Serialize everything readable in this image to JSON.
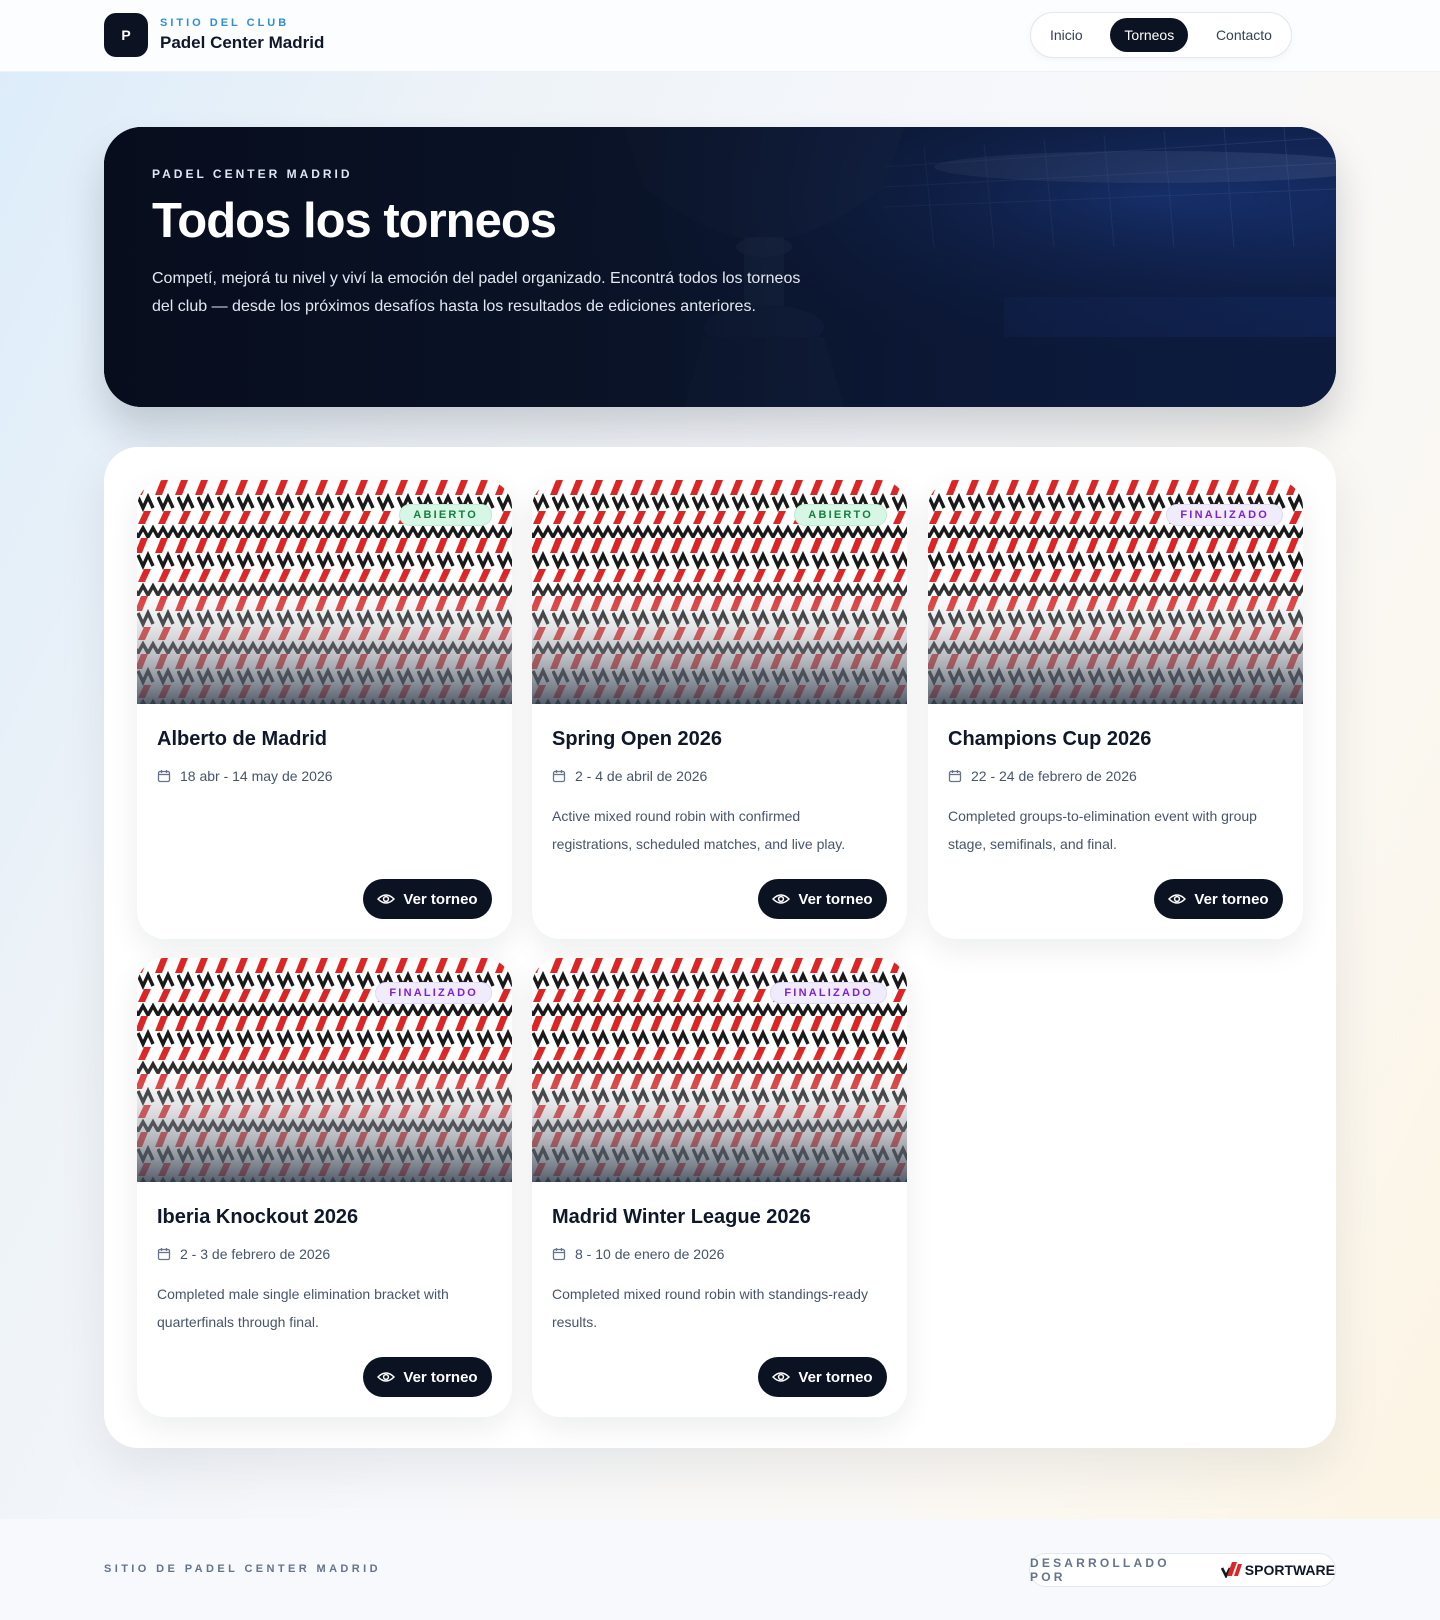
{
  "header": {
    "badge_letter": "P",
    "kicker": "SITIO DEL CLUB",
    "club_name": "Padel Center Madrid",
    "nav": [
      {
        "label": "Inicio",
        "active": false
      },
      {
        "label": "Torneos",
        "active": true
      },
      {
        "label": "Contacto",
        "active": false
      }
    ]
  },
  "hero": {
    "kicker": "PADEL CENTER MADRID",
    "title": "Todos los torneos",
    "description": "Competí, mejorá tu nivel y viví la emoción del padel organizado. Encontrá todos los torneos del club — desde los próximos desafíos hasta los resultados de ediciones anteriores."
  },
  "tournaments": [
    {
      "title": "Alberto de Madrid",
      "dates": "18 abr - 14 may de 2026",
      "description": "",
      "status": "ABIERTO",
      "status_type": "open",
      "button": "Ver torneo"
    },
    {
      "title": "Spring Open 2026",
      "dates": "2 - 4 de abril de 2026",
      "description": "Active mixed round robin with confirmed registrations, scheduled matches, and live play.",
      "status": "ABIERTO",
      "status_type": "open",
      "button": "Ver torneo"
    },
    {
      "title": "Champions Cup 2026",
      "dates": "22 - 24 de febrero de 2026",
      "description": "Completed groups-to-elimination event with group stage, semifinals, and final.",
      "status": "FINALIZADO",
      "status_type": "done",
      "button": "Ver torneo"
    },
    {
      "title": "Iberia Knockout 2026",
      "dates": "2 - 3 de febrero de 2026",
      "description": "Completed male single elimination bracket with quarterfinals through final.",
      "status": "FINALIZADO",
      "status_type": "done",
      "button": "Ver torneo"
    },
    {
      "title": "Madrid Winter League 2026",
      "dates": "8 - 10 de enero de 2026",
      "description": "Completed mixed round robin with standings-ready results.",
      "status": "FINALIZADO",
      "status_type": "done",
      "button": "Ver torneo"
    }
  ],
  "footer": {
    "left": "SITIO DE PADEL CENTER MADRID",
    "developed_by": "DESARROLLADO POR",
    "brand": "SPORTWARE"
  },
  "colors": {
    "dark": "#0b1222",
    "accent": "#2f8fcf",
    "open_bg": "#d7f6e6",
    "open_text": "#15803d",
    "done_bg": "#f1ecfc",
    "done_text": "#7e22ce",
    "pattern_red": "#dc2626",
    "pattern_black": "#1a1a1a"
  },
  "icons": [
    "calendar-icon",
    "eye-icon",
    "trophy-image",
    "sportware-logo"
  ]
}
